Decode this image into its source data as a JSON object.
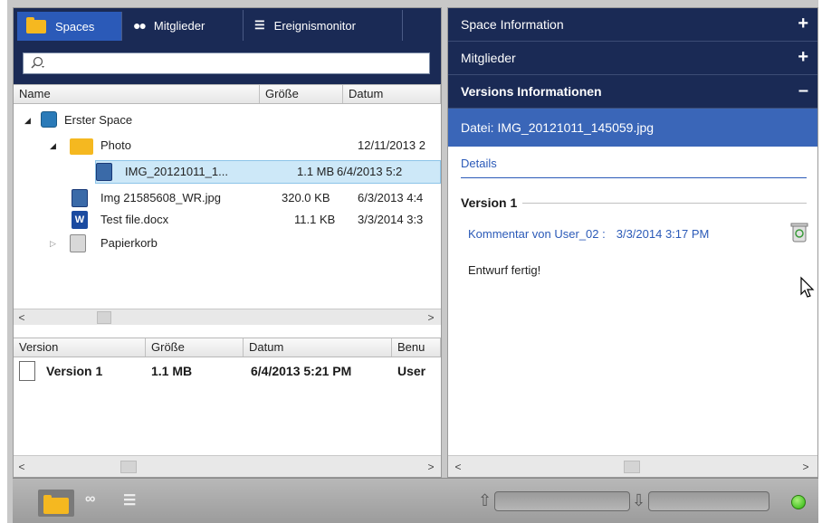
{
  "tabs": [
    {
      "label": "Spaces",
      "icon": "folder-icon",
      "active": true
    },
    {
      "label": "Mitglieder",
      "icon": "people-icon",
      "active": false
    },
    {
      "label": "Ereignismonitor",
      "icon": "monitor-icon",
      "active": false
    }
  ],
  "search": {
    "placeholder": "",
    "icon": "search-icon"
  },
  "file_table": {
    "columns": [
      "Name",
      "Größe",
      "Datum"
    ],
    "rows": [
      {
        "name": "Erster Space",
        "size": "",
        "date": "",
        "icon": "space-icon",
        "expanded": true
      },
      {
        "name": "Photo",
        "size": "",
        "date": "12/11/2013 2",
        "icon": "folder-icon",
        "expanded": true
      },
      {
        "name": "IMG_20121011_1...",
        "size": "1.1 MB",
        "date": "6/4/2013 5:2",
        "icon": "image-file-icon",
        "selected": true
      },
      {
        "name": "Img 21585608_WR.jpg",
        "size": "320.0 KB",
        "date": "6/3/2013 4:4",
        "icon": "image-file-icon"
      },
      {
        "name": "Test file.docx",
        "size": "11.1 KB",
        "date": "3/3/2014 3:3",
        "icon": "word-file-icon"
      },
      {
        "name": "Papierkorb",
        "size": "",
        "date": "",
        "icon": "recycle-bin-icon",
        "expanded": false
      }
    ]
  },
  "version_table": {
    "columns": [
      "Version",
      "Größe",
      "Datum",
      "Benu"
    ],
    "rows": [
      {
        "version": "Version 1",
        "size": "1.1 MB",
        "date": "6/4/2013 5:21 PM",
        "user": "User"
      }
    ]
  },
  "right": {
    "sections": [
      {
        "label": "Space Information",
        "toggle": "+"
      },
      {
        "label": "Mitglieder",
        "toggle": "+"
      },
      {
        "label": "Versions Informationen",
        "toggle": "–"
      }
    ],
    "file_label": "Datei: IMG_20121011_145059.jpg",
    "details_label": "Details",
    "version_title": "Version 1",
    "comment_by": "Kommentar von  User_02 :",
    "comment_date": "3/3/2014 3:17 PM",
    "comment_text": "Entwurf fertig!"
  },
  "colors": {
    "header_bg": "#1a2a55",
    "tab_active": "#2b5ab8",
    "file_bar": "#3a66b8",
    "link": "#2b5ab8",
    "status": "#28b40a"
  }
}
